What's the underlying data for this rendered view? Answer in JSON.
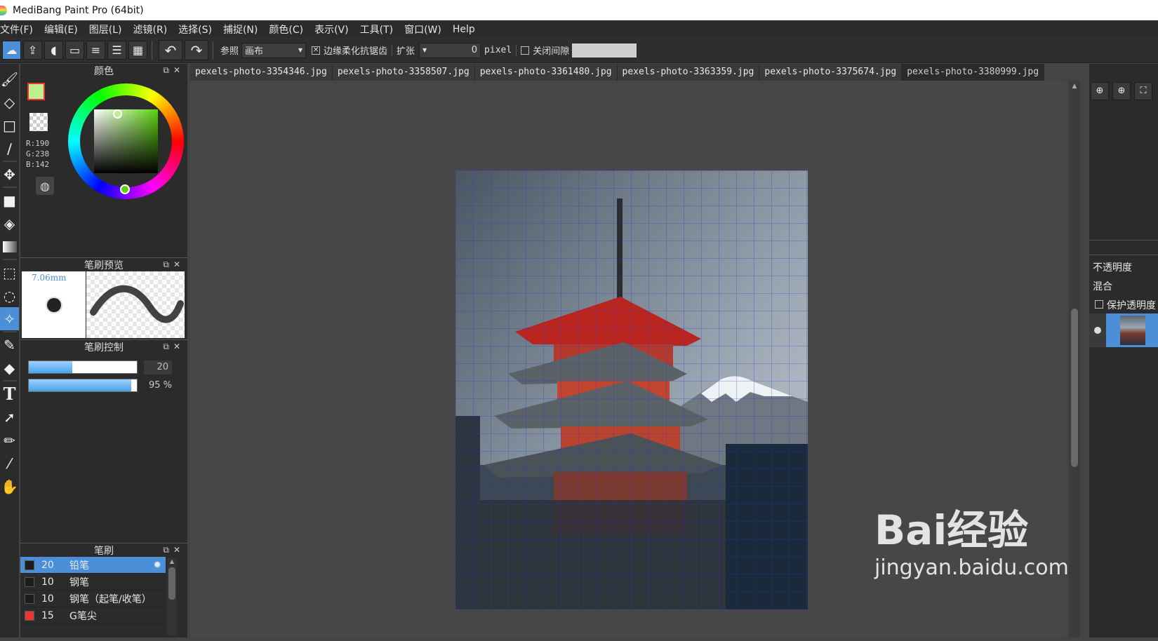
{
  "window": {
    "title": "MediBang Paint Pro (64bit)"
  },
  "menu": [
    "文件(F)",
    "编辑(E)",
    "图层(L)",
    "滤镜(R)",
    "选择(S)",
    "捕捉(N)",
    "颜色(C)",
    "表示(V)",
    "工具(T)",
    "窗口(W)",
    "Help"
  ],
  "toolbar": {
    "reference_label": "参照",
    "reference_value": "画布",
    "antialias_label": "边缘柔化抗锯齿",
    "expand_label": "扩张",
    "expand_value": "0",
    "unit": "pixel",
    "close_gap_label": "关闭间隙"
  },
  "color_panel": {
    "title": "颜色",
    "foreground": "#bfee8e",
    "r_text": "R:190",
    "g_text": "G:238",
    "b_text": "B:142"
  },
  "brush_preview": {
    "title": "笔刷预览",
    "size_text": "7.06mm"
  },
  "brush_control": {
    "title": "笔刷控制",
    "size_value": "20",
    "opacity_value": "95 %",
    "size_fraction": 0.4,
    "opacity_fraction": 0.95
  },
  "brush_list": {
    "title": "笔刷",
    "items": [
      {
        "size": "20",
        "name": "铅笔",
        "color": "#1d1d1d",
        "selected": true
      },
      {
        "size": "10",
        "name": "钢笔",
        "color": "#1d1d1d",
        "selected": false
      },
      {
        "size": "10",
        "name": "钢笔（起笔/收笔）",
        "color": "#1d1d1d",
        "selected": false
      },
      {
        "size": "15",
        "name": "G笔尖",
        "color": "#e83535",
        "selected": false
      }
    ]
  },
  "tabs": [
    "pexels-photo-3354346.jpg",
    "pexels-photo-3358507.jpg",
    "pexels-photo-3361480.jpg",
    "pexels-photo-3363359.jpg",
    "pexels-photo-3375674.jpg",
    "pexels-photo-3380999.jpg"
  ],
  "active_tab": 5,
  "layer_panel": {
    "opacity_label": "不透明度",
    "blend_label": "混合",
    "protect_label": "保护透明度"
  },
  "watermark": {
    "brand": "Bai经验",
    "url": "jingyan.baidu.com"
  }
}
